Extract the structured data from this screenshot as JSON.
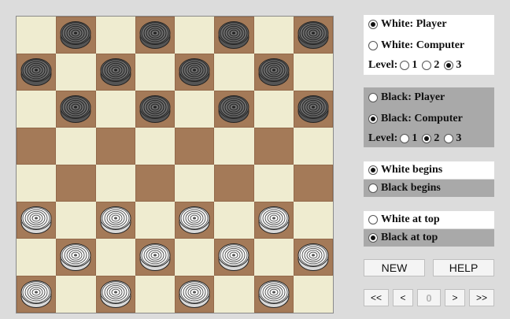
{
  "board": {
    "rows": 8,
    "cols": 8,
    "pieces": [
      "-b-b-b-b",
      "b-b-b-b-",
      "-b-b-b-b",
      "--------",
      "--------",
      "w-w-w-w-",
      "-w-w-w-w",
      "w-w-w-w-"
    ],
    "colors": {
      "light": "#efecd0",
      "dark": "#a47a58"
    }
  },
  "white_settings": {
    "player_label": "White: Player",
    "computer_label": "White: Computer",
    "selected": "player",
    "level_label": "Level:",
    "levels": [
      "1",
      "2",
      "3"
    ],
    "selected_level": "3"
  },
  "black_settings": {
    "player_label": "Black: Player",
    "computer_label": "Black: Computer",
    "selected": "computer",
    "level_label": "Level:",
    "levels": [
      "1",
      "2",
      "3"
    ],
    "selected_level": "2"
  },
  "start": {
    "white_begins_label": "White begins",
    "black_begins_label": "Black begins",
    "selected": "white"
  },
  "orientation": {
    "white_top_label": "White at top",
    "black_top_label": "Black at top",
    "selected": "black"
  },
  "buttons": {
    "new_label": "NEW",
    "help_label": "HELP"
  },
  "nav": {
    "first": "<<",
    "prev": "<",
    "move_number": "0",
    "next": ">",
    "last": ">>"
  }
}
